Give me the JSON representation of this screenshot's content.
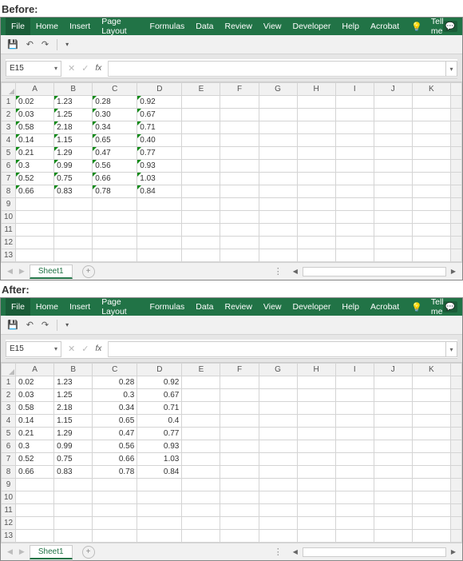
{
  "labels": {
    "before": "Before:",
    "after": "After:"
  },
  "ribbon": {
    "tabs": [
      "File",
      "Home",
      "Insert",
      "Page Layout",
      "Formulas",
      "Data",
      "Review",
      "View",
      "Developer",
      "Help",
      "Acrobat"
    ],
    "tellme": "Tell me"
  },
  "namebox": "E15",
  "fx_label": "fx",
  "columns": [
    "A",
    "B",
    "C",
    "D",
    "E",
    "F",
    "G",
    "H",
    "I",
    "J",
    "K"
  ],
  "row_headers": [
    "1",
    "2",
    "3",
    "4",
    "5",
    "6",
    "7",
    "8",
    "9",
    "10",
    "11",
    "12",
    "13"
  ],
  "sheet_tab": "Sheet1",
  "before_data": {
    "align": "left",
    "errmark": true,
    "rows": [
      [
        "0.02",
        "1.23",
        "0.28",
        "0.92"
      ],
      [
        "0.03",
        "1.25",
        "0.30",
        "0.67"
      ],
      [
        "0.58",
        "2.18",
        "0.34",
        "0.71"
      ],
      [
        "0.14",
        "1.15",
        "0.65",
        "0.40"
      ],
      [
        "0.21",
        "1.29",
        "0.47",
        "0.77"
      ],
      [
        "0.3",
        "0.99",
        "0.56",
        "0.93"
      ],
      [
        "0.52",
        "0.75",
        "0.66",
        "1.03"
      ],
      [
        "0.66",
        "0.83",
        "0.78",
        "0.84"
      ]
    ]
  },
  "after_data": {
    "rows": [
      {
        "ab": [
          "0.02",
          "1.23"
        ],
        "cd": [
          "0.28",
          "0.92"
        ]
      },
      {
        "ab": [
          "0.03",
          "1.25"
        ],
        "cd": [
          "0.3",
          "0.67"
        ]
      },
      {
        "ab": [
          "0.58",
          "2.18"
        ],
        "cd": [
          "0.34",
          "0.71"
        ]
      },
      {
        "ab": [
          "0.14",
          "1.15"
        ],
        "cd": [
          "0.65",
          "0.4"
        ]
      },
      {
        "ab": [
          "0.21",
          "1.29"
        ],
        "cd": [
          "0.47",
          "0.77"
        ]
      },
      {
        "ab": [
          "0.3",
          "0.99"
        ],
        "cd": [
          "0.56",
          "0.93"
        ]
      },
      {
        "ab": [
          "0.52",
          "0.75"
        ],
        "cd": [
          "0.66",
          "1.03"
        ]
      },
      {
        "ab": [
          "0.66",
          "0.83"
        ],
        "cd": [
          "0.78",
          "0.84"
        ]
      }
    ]
  }
}
